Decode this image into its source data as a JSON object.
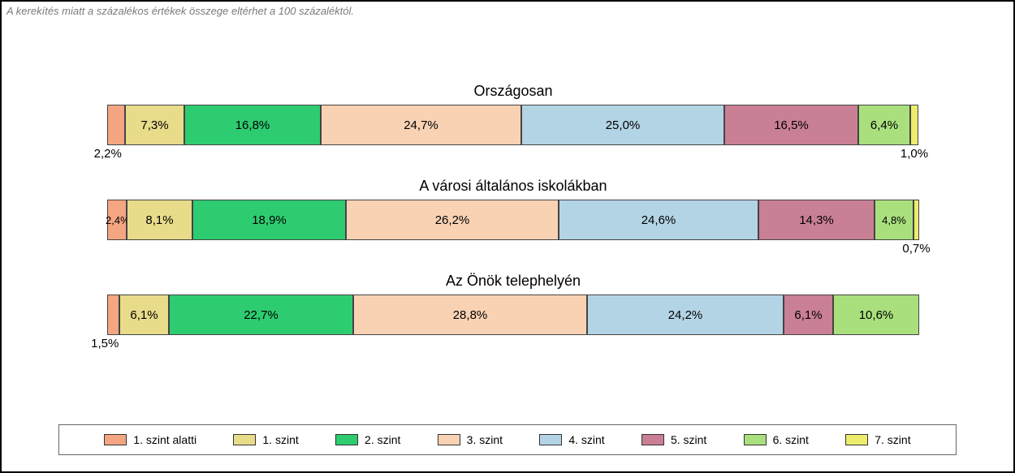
{
  "note": "A kerekítés miatt a százalékos értékek összege eltérhet a 100 százaléktól.",
  "chart_data": {
    "type": "bar",
    "stacked": true,
    "orientation": "horizontal",
    "unit": "percent",
    "categories": [
      "Országosan",
      "A városi általános iskolákban",
      "Az Önök telephelyén"
    ],
    "series": [
      {
        "name": "1. szint alatti",
        "color": "#f4a582",
        "values": [
          2.2,
          2.4,
          1.5
        ]
      },
      {
        "name": "1. szint",
        "color": "#e8db8a",
        "values": [
          7.3,
          8.1,
          6.1
        ]
      },
      {
        "name": "2. szint",
        "color": "#2ecc71",
        "values": [
          16.8,
          18.9,
          22.7
        ]
      },
      {
        "name": "3. szint",
        "color": "#f9d2b4",
        "values": [
          24.7,
          26.2,
          28.8
        ]
      },
      {
        "name": "4. szint",
        "color": "#b3d4e5",
        "values": [
          25.0,
          24.6,
          24.2
        ]
      },
      {
        "name": "5. szint",
        "color": "#c97f94",
        "values": [
          16.5,
          14.3,
          6.1
        ]
      },
      {
        "name": "6. szint",
        "color": "#a9e07d",
        "values": [
          6.4,
          4.8,
          10.6
        ]
      },
      {
        "name": "7. szint",
        "color": "#eced6c",
        "values": [
          1.0,
          0.7,
          0.0
        ]
      }
    ],
    "labels": {
      "bar0": [
        "2,2%",
        "7,3%",
        "16,8%",
        "24,7%",
        "25,0%",
        "16,5%",
        "6,4%",
        "1,0%"
      ],
      "bar1": [
        "2,4%",
        "8,1%",
        "18,9%",
        "26,2%",
        "24,6%",
        "14,3%",
        "4,8%",
        "0,7%"
      ],
      "bar2": [
        "1,5%",
        "6,1%",
        "22,7%",
        "28,8%",
        "24,2%",
        "6,1%",
        "10,6%",
        ""
      ]
    },
    "legend_labels": [
      "1. szint alatti",
      "1. szint",
      "2. szint",
      "3. szint",
      "4. szint",
      "5. szint",
      "6. szint",
      "7. szint"
    ]
  }
}
